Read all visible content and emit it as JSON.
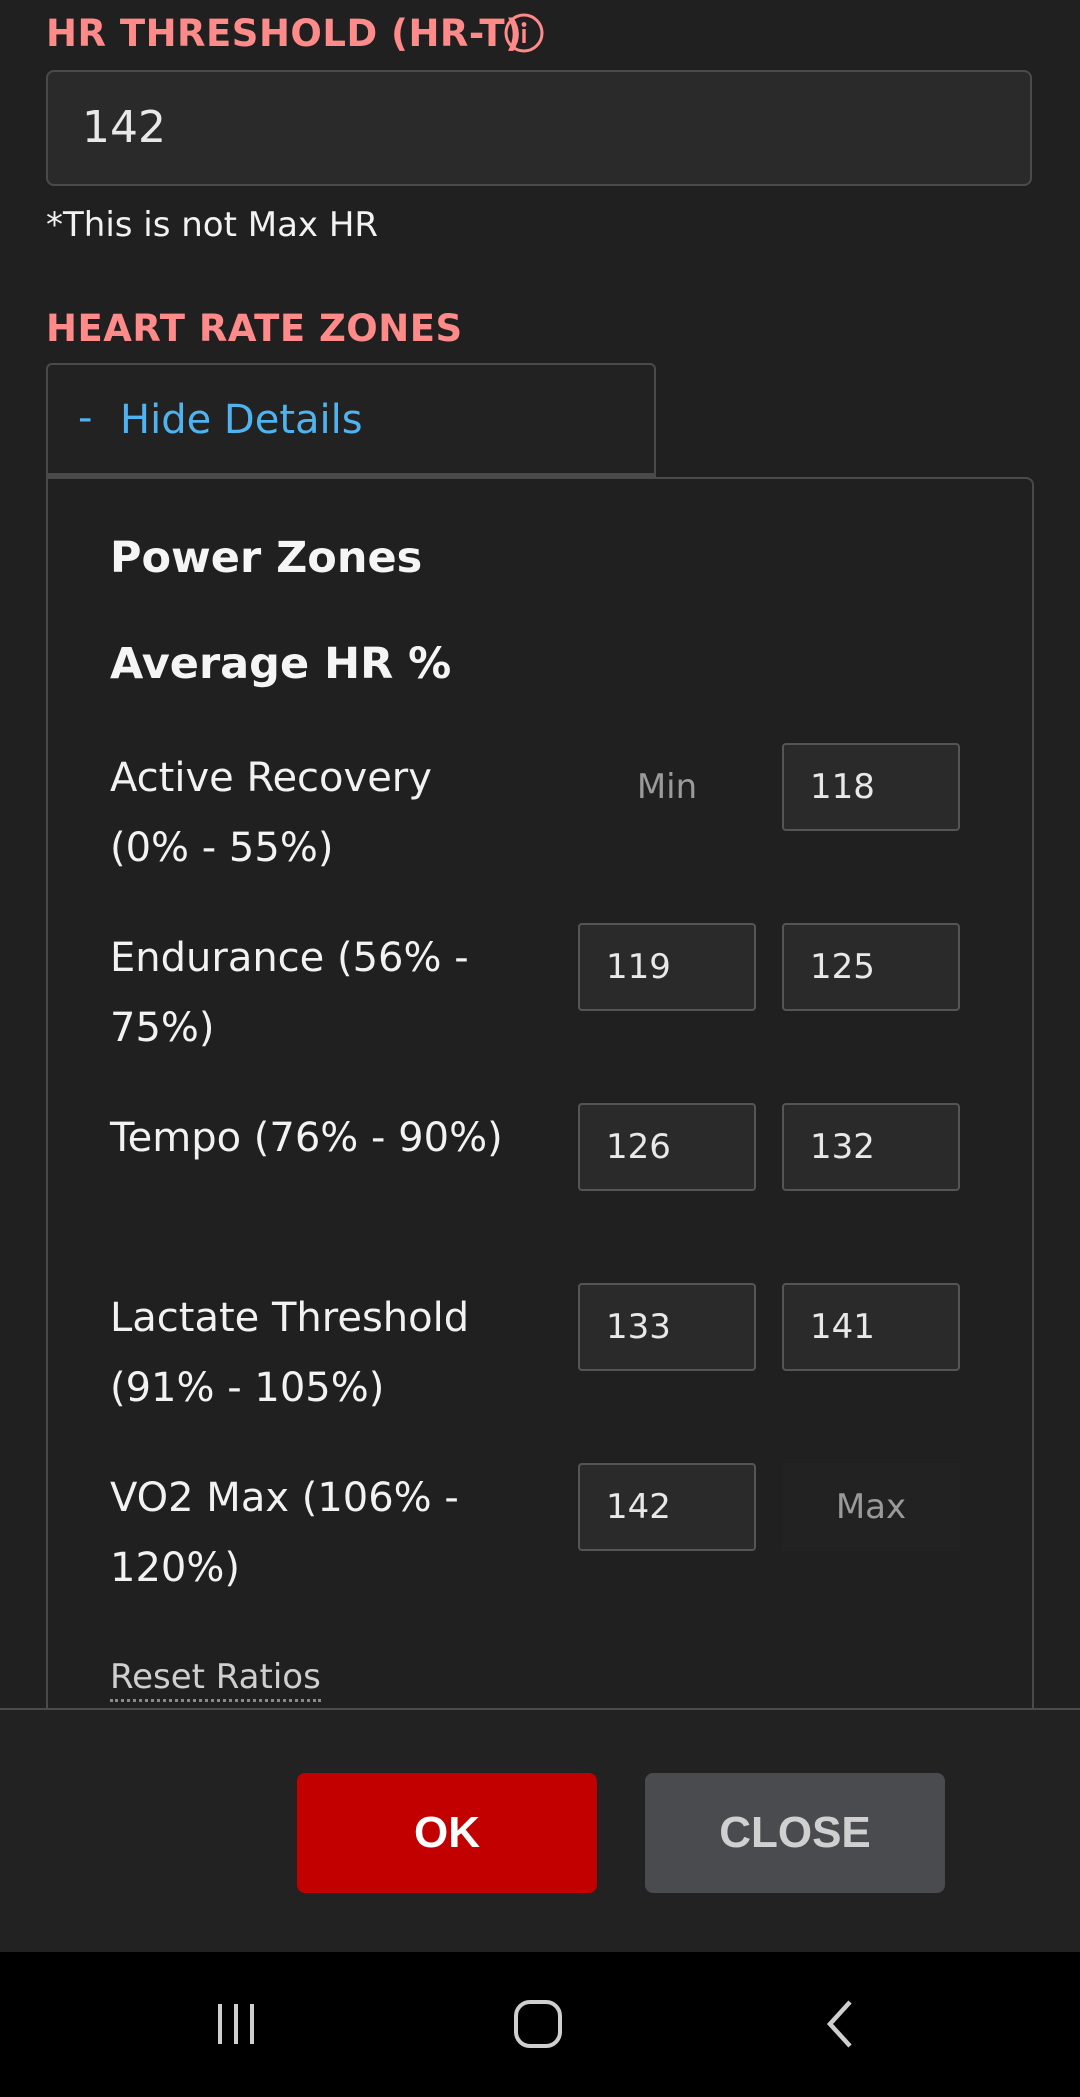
{
  "settings": {
    "hr_threshold_label": "HR THRESHOLD (HR-T)",
    "hr_threshold_value": "142",
    "note": "*This is not Max HR",
    "zones_label": "HEART RATE ZONES",
    "toggle_symbol": "-",
    "toggle_label": "Hide Details"
  },
  "panel": {
    "power_title": "Power Zones",
    "avg_title": "Average HR %",
    "reset_label": "Reset Ratios",
    "zones": [
      {
        "name": "Active Recovery (0% - 55%)",
        "min": "Min",
        "max": "118"
      },
      {
        "name": "Endurance (56% - 75%)",
        "min": "119",
        "max": "125"
      },
      {
        "name": "Tempo (76% - 90%)",
        "min": "126",
        "max": "132"
      },
      {
        "name": "Lactate Threshold (91% - 105%)",
        "min": "133",
        "max": "141"
      },
      {
        "name": "VO2 Max (106% - 120%)",
        "min": "142",
        "max": "Max"
      }
    ]
  },
  "footer": {
    "ok_label": "OK",
    "close_label": "CLOSE"
  },
  "icons": {
    "info": "info-icon",
    "recents": "recent-apps-icon",
    "home": "home-icon",
    "back": "back-icon"
  },
  "colors": {
    "accent_label": "#ff8a8a",
    "link_blue": "#4fb3f0",
    "ok_red": "#c30000",
    "close_gray": "#4a4b4f"
  }
}
